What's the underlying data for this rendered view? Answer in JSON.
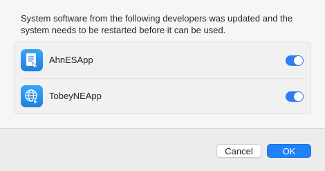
{
  "dialog": {
    "message": "System software from the following developers was updated and the system needs to be restarted before it can be used."
  },
  "apps": [
    {
      "name": "AhnESApp",
      "icon": "document-icon",
      "enabled": true
    },
    {
      "name": "TobeyNEApp",
      "icon": "globe-icon",
      "enabled": true
    }
  ],
  "buttons": {
    "cancel_label": "Cancel",
    "ok_label": "OK"
  },
  "colors": {
    "accent": "#1f82f6",
    "toggle_on": "#2e7cf6",
    "icon_bg": "#2a8ff0"
  }
}
